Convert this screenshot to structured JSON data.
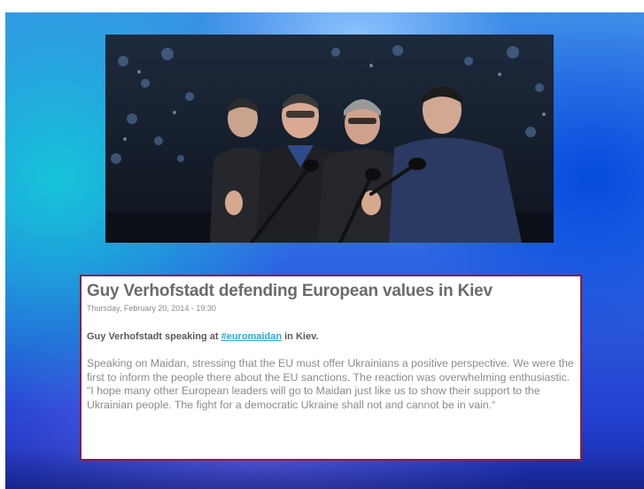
{
  "article": {
    "title": "Guy Verhofstadt defending European values in Kiev",
    "date": "Thursday, February 20, 2014 - 19:30",
    "lead_before": "Guy Verhofstadt speaking at ",
    "lead_link": "#euromaidan",
    "lead_after": " in Kiev.",
    "body": "Speaking on Maidan, stressing that the EU must offer Ukrainians a positive perspective. We were the first to inform the people there about the EU sanctions. The reaction was overwhelming enthusiastic. \"I hope many other European leaders will go to Maidan just like us to show their support to the Ukrainian people. The fight for a democratic Ukraine shall not and cannot be in vain.“"
  },
  "colors": {
    "frame_border": "#8a1f3b",
    "link": "#2aa9e0",
    "title_text": "#6b6b6b",
    "body_text": "#8b8b8b"
  }
}
